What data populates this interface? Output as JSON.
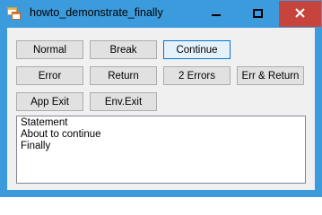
{
  "window": {
    "title": "howto_demonstrate_finally",
    "icon": "winforms-app-icon",
    "controls": {
      "minimize_icon": "minimize-icon",
      "maximize_icon": "maximize-icon",
      "close_icon": "close-icon"
    },
    "colors": {
      "titlebar": "#3b9bdd",
      "close_button": "#c7443c",
      "client": "#f0f0f0"
    }
  },
  "buttons": {
    "normal": "Normal",
    "break": "Break",
    "continue": "Continue",
    "error": "Error",
    "return": "Return",
    "two_errors": "2 Errors",
    "err_and_return": "Err & Return",
    "app_exit": "App Exit",
    "env_exit": "Env.Exit"
  },
  "output": {
    "lines": [
      "Statement",
      "About to continue",
      "Finally"
    ]
  }
}
